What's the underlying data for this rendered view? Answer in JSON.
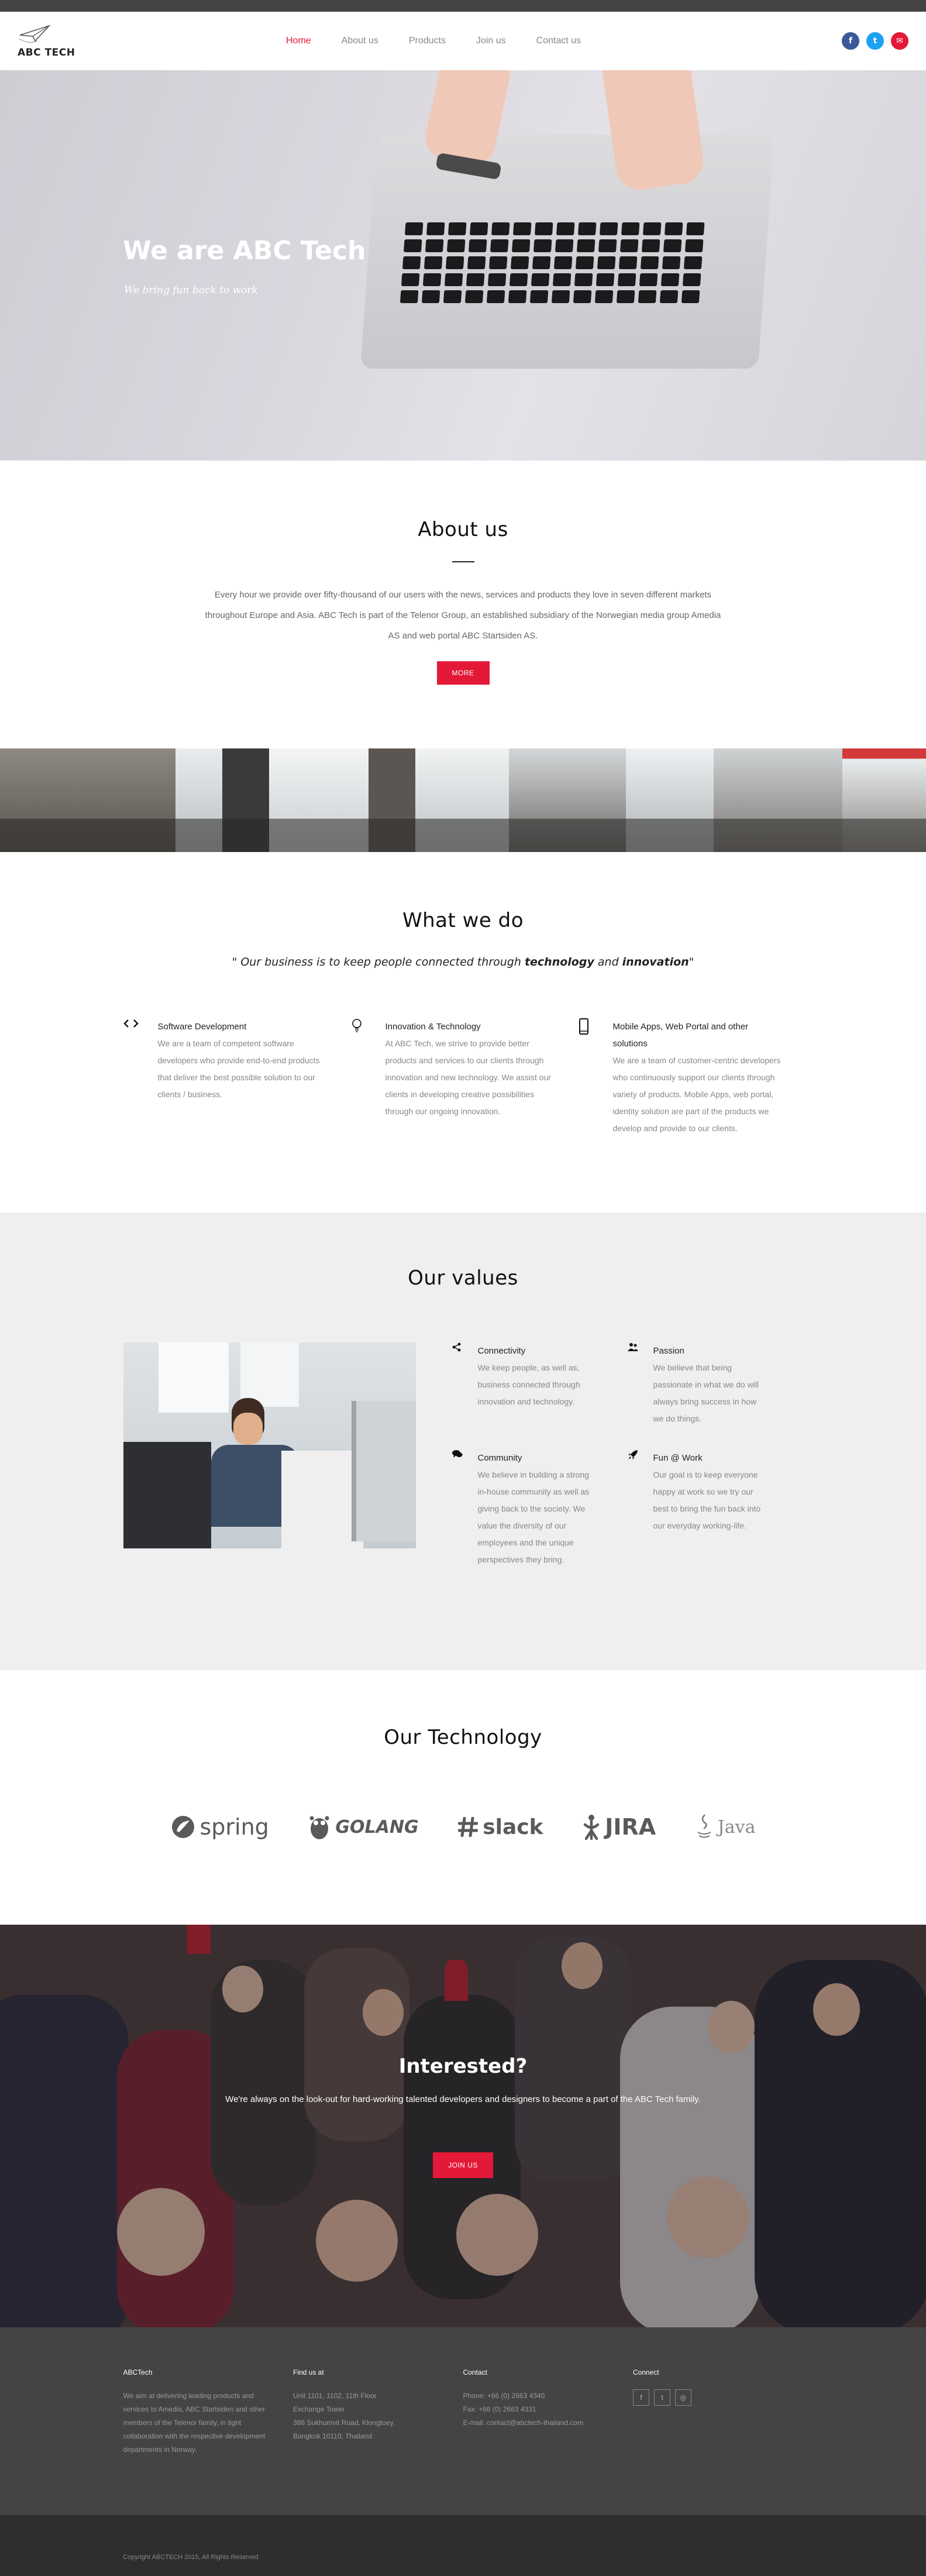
{
  "brand": {
    "logo_text": "ABC TECH"
  },
  "nav": {
    "items": [
      {
        "label": "Home",
        "active": true
      },
      {
        "label": "About us",
        "active": false
      },
      {
        "label": "Products",
        "active": false
      },
      {
        "label": "Join us",
        "active": false
      },
      {
        "label": "Contact us",
        "active": false
      }
    ]
  },
  "header_social": [
    {
      "icon": "facebook-icon",
      "glyph": "f",
      "color": "#3b5998"
    },
    {
      "icon": "twitter-icon",
      "glyph": "t",
      "color": "#1da1f2"
    },
    {
      "icon": "email-icon",
      "glyph": "✉",
      "color": "#e31937"
    }
  ],
  "hero": {
    "title": "We are ABC Tech",
    "subtitle": "We bring fun back to work"
  },
  "about": {
    "title": "About us",
    "text": "Every hour we provide over fifty-thousand of our users with the news, services and products they love in seven different markets throughout Europe and Asia. ABC Tech is part of the Telenor Group, an established subsidiary of the Norwegian media group Amedia AS and web portal ABC Startsiden AS.",
    "button": "MORE"
  },
  "whatwedo": {
    "title": "What we do",
    "quote_start": "\" Our business is to keep people connected through ",
    "quote_b1": "technology",
    "quote_mid": " and ",
    "quote_b2": "innovation",
    "quote_end": "\"",
    "items": [
      {
        "icon": "code-icon",
        "title": "Software Development",
        "text": "We are a team of competent software developers who provide end-to-end products that deliver the best possible solution to our clients / business."
      },
      {
        "icon": "lightbulb-icon",
        "title": "Innovation & Technology",
        "text": "At ABC Tech, we strive to provide better products and services to our clients through innovation and new technology. We assist our clients in developing creative possibilities through our ongoing innovation."
      },
      {
        "icon": "mobile-icon",
        "title": "Mobile Apps, Web Portal and other solutions",
        "text": "We are a team of customer-centric developers who continuously support our clients through variety of products. Mobile Apps, web portal, identity solution are part of the products we develop and provide to our clients."
      }
    ]
  },
  "values": {
    "title": "Our values",
    "items": [
      {
        "icon": "share-icon",
        "title": "Connectivity",
        "text": "We keep people, as well as, business connected through innovation and technology."
      },
      {
        "icon": "users-icon",
        "title": "Passion",
        "text": "We believe that being passionate in what we do will always bring success in how we do things."
      },
      {
        "icon": "comments-icon",
        "title": "Community",
        "text": "We believe in building a strong in-house community as well as giving back to the society. We value the diversity of our employees and the unique perspectives they bring."
      },
      {
        "icon": "rocket-icon",
        "title": "Fun @ Work",
        "text": "Our goal is to keep everyone happy at work so we try our best to bring the fun back into our everyday working-life."
      }
    ]
  },
  "technology": {
    "title": "Our Technology",
    "logos": [
      {
        "name": "spring",
        "icon": "spring-logo-icon"
      },
      {
        "name": "GOLANG",
        "icon": "golang-logo-icon"
      },
      {
        "name": "slack",
        "icon": "slack-logo-icon"
      },
      {
        "name": "JIRA",
        "icon": "jira-logo-icon"
      },
      {
        "name": "Java",
        "icon": "java-logo-icon"
      }
    ]
  },
  "interested": {
    "title": "Interested?",
    "text": "We're always on the look-out for hard-working talented developers and designers to become a part of the ABC Tech family.",
    "button": "JOIN US"
  },
  "footer": {
    "col1": {
      "title": "ABCTech",
      "text": "We aim at delivering leading products and services to Amedia, ABC Startsiden and other members of the Telenor family, in tight collaboration with the respective development departments in Norway."
    },
    "col2": {
      "title": "Find us at",
      "lines": [
        "Unit 1101, 1102, 11th Floor",
        "Exchange Tower",
        "388 Sukhumvit Road, Klongtoey,",
        "Bangkok 10110, Thailand"
      ]
    },
    "col3": {
      "title": "Contact",
      "lines": [
        "Phone: +66 (0) 2663 4340",
        "Fax: +66 (0) 2663 4331",
        "E-mail: contact@abctech-thailand.com"
      ]
    },
    "col4": {
      "title": "Connect",
      "social": [
        {
          "icon": "facebook-icon",
          "glyph": "f"
        },
        {
          "icon": "twitter-icon",
          "glyph": "t"
        },
        {
          "icon": "instagram-icon",
          "glyph": "◎"
        }
      ]
    },
    "copyright": "Copyright ABCTECH 2015, All Rights Reserved"
  }
}
